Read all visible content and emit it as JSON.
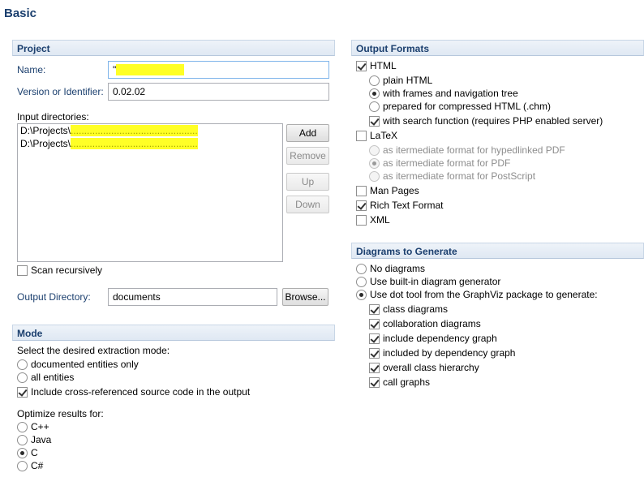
{
  "page": {
    "title": "Basic"
  },
  "project": {
    "header": "Project",
    "name_label": "Name:",
    "name_value": "\"",
    "version_label": "Version or Identifier:",
    "version_value": "0.02.02",
    "input_dirs_label": "Input directories:",
    "input_dirs": [
      {
        "prefix": "D:\\Projects\\",
        "rest": "..............................................."
      },
      {
        "prefix": "D:\\Projects\\",
        "rest": "..............................................."
      }
    ],
    "add": "Add",
    "remove": "Remove",
    "up": "Up",
    "down": "Down",
    "scan_recursively": "Scan recursively",
    "scan_recursively_checked": false,
    "output_dir_label": "Output Directory:",
    "output_dir_value": "documents",
    "browse": "Browse..."
  },
  "mode": {
    "header": "Mode",
    "extraction_label": "Select the desired extraction mode:",
    "documented_only": "documented entities only",
    "all_entities": "all entities",
    "include_cross_ref": "Include cross-referenced source code in the output",
    "include_cross_ref_checked": true,
    "optimize_label": "Optimize results for:",
    "langs": [
      "C++",
      "Java",
      "C",
      "C#"
    ],
    "selected_lang": "C"
  },
  "output_formats": {
    "header": "Output Formats",
    "html": "HTML",
    "html_checked": true,
    "plain_html": "plain HTML",
    "frames_nav": "with frames and navigation tree",
    "compressed_html": "prepared for compressed HTML (.chm)",
    "search_function": "with search function (requires PHP enabled server)",
    "search_function_checked": true,
    "latex": "LaTeX",
    "latex_checked": false,
    "latex_hyperlinked": "as itermediate format for hypedlinked PDF",
    "latex_pdf": "as itermediate format for PDF",
    "latex_postscript": "as itermediate format for PostScript",
    "man_pages": "Man Pages",
    "rtf": "Rich Text Format",
    "rtf_checked": true,
    "xml": "XML"
  },
  "diagrams": {
    "header": "Diagrams to Generate",
    "no_diagrams": "No diagrams",
    "builtin": "Use built-in diagram generator",
    "dot_tool": "Use dot tool from the GraphViz package to generate:",
    "items": [
      "class diagrams",
      "collaboration diagrams",
      "include dependency graph",
      "included by dependency graph",
      "overall class hierarchy",
      "call graphs"
    ]
  }
}
